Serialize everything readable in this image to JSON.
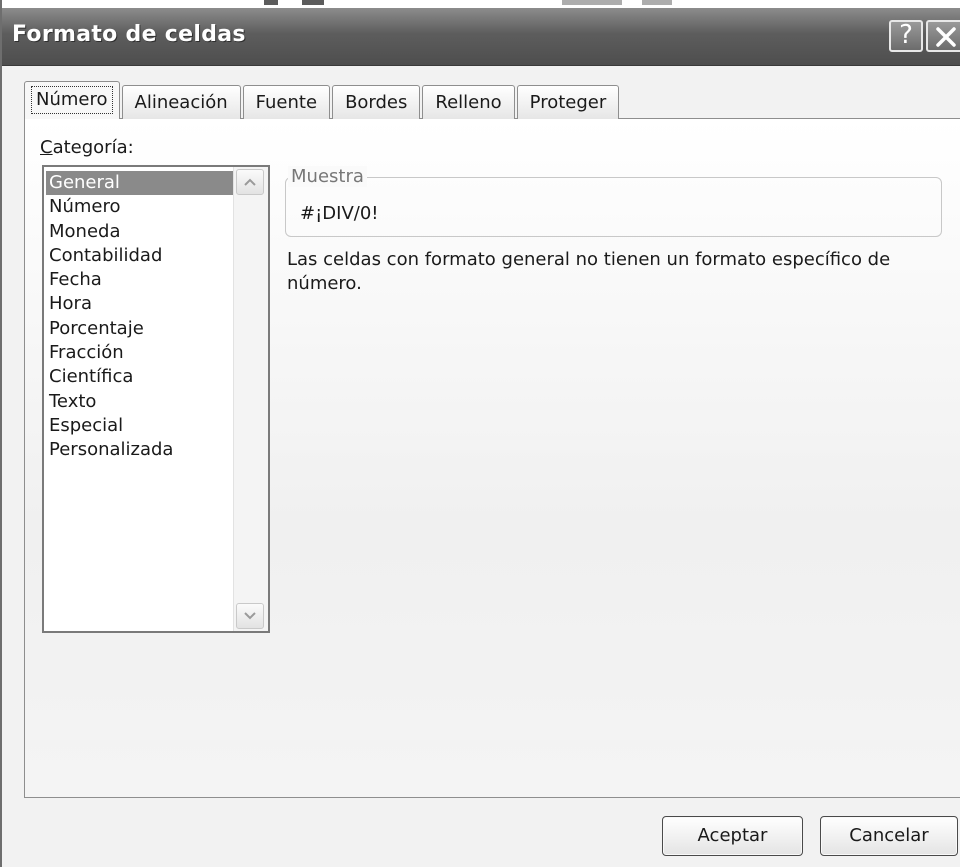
{
  "window": {
    "title": "Formato de celdas"
  },
  "titlebar": {
    "help_glyph": "?"
  },
  "tabs": [
    {
      "label": "Número",
      "active": true
    },
    {
      "label": "Alineación",
      "active": false
    },
    {
      "label": "Fuente",
      "active": false
    },
    {
      "label": "Bordes",
      "active": false
    },
    {
      "label": "Relleno",
      "active": false
    },
    {
      "label": "Proteger",
      "active": false
    }
  ],
  "category": {
    "label_first": "C",
    "label_rest": "ategoría:",
    "items": [
      "General",
      "Número",
      "Moneda",
      "Contabilidad",
      "Fecha",
      "Hora",
      "Porcentaje",
      "Fracción",
      "Científica",
      "Texto",
      "Especial",
      "Personalizada"
    ],
    "selected": "General"
  },
  "sample": {
    "legend": "Muestra",
    "value": "#¡DIV/0!"
  },
  "description": "Las celdas con formato general no tienen un formato específico de número.",
  "buttons": {
    "ok": "Aceptar",
    "cancel": "Cancelar"
  },
  "icons": {
    "help": "help-icon",
    "close": "close-icon",
    "scroll_up": "chevron-up-icon",
    "scroll_down": "chevron-down-icon"
  }
}
